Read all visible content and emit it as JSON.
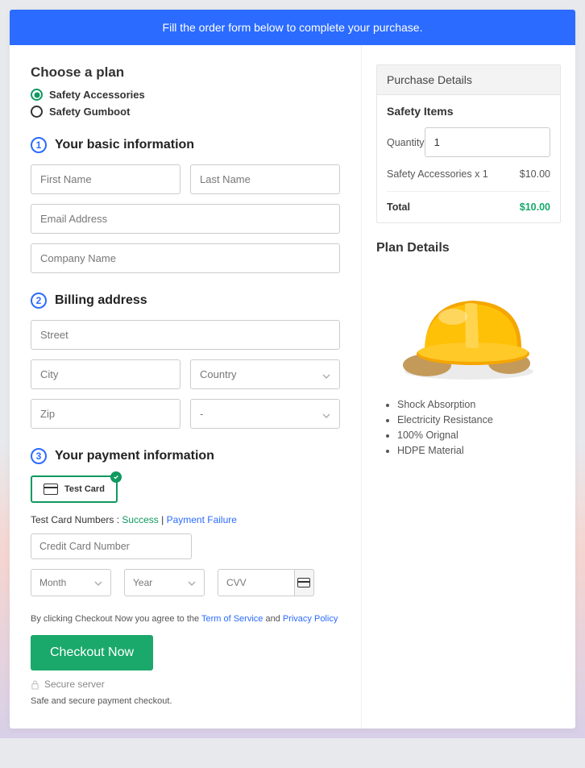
{
  "banner": "Fill the order form below to complete your purchase.",
  "choose_plan": {
    "title": "Choose a plan",
    "options": [
      "Safety Accessories",
      "Safety Gumboot"
    ]
  },
  "step1": {
    "num": "1",
    "title": "Your basic information",
    "first_name_ph": "First Name",
    "last_name_ph": "Last Name",
    "email_ph": "Email Address",
    "company_ph": "Company Name"
  },
  "step2": {
    "num": "2",
    "title": "Billing address",
    "street_ph": "Street",
    "city_ph": "City",
    "country_ph": "Country",
    "zip_ph": "Zip",
    "state_ph": "-"
  },
  "step3": {
    "num": "3",
    "title": "Your payment information",
    "test_card_label": "Test  Card",
    "tcn_label": "Test Card Numbers :",
    "success_label": "Success",
    "sep": "|",
    "failure_label": "Payment Failure",
    "cc_ph": "Credit Card Number",
    "month_ph": "Month",
    "year_ph": "Year",
    "cvv_ph": "CVV"
  },
  "agree": {
    "pre": "By clicking Checkout Now you agree to the ",
    "tos": "Term of Service",
    "mid": " and ",
    "pp": "Privacy Policy"
  },
  "checkout_label": "Checkout Now",
  "secure_label": "Secure server",
  "safe_note": "Safe and secure payment checkout.",
  "purchase": {
    "heading": "Purchase Details",
    "subheading": "Safety Items",
    "qty_label": "Quantity",
    "qty_value": "1",
    "line_item": "Safety Accessories x 1",
    "line_price": "$10.00",
    "total_label": "Total",
    "total_price": "$10.00"
  },
  "plan_details": {
    "title": "Plan Details",
    "features": [
      "Shock Absorption",
      "Electricity Resistance",
      "100% Orignal",
      "HDPE Material"
    ]
  }
}
